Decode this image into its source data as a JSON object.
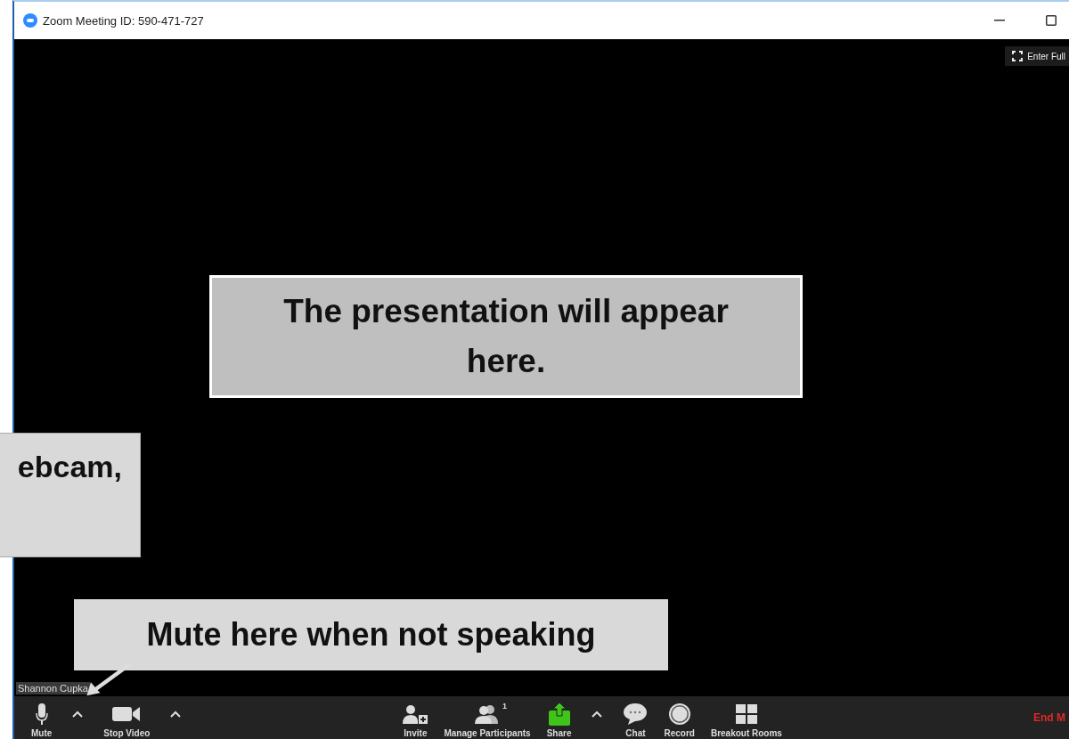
{
  "window": {
    "title": "Zoom Meeting ID: 590-471-727"
  },
  "full_screen_button": {
    "label": "Enter Full"
  },
  "participant_name": "Shannon Cupka",
  "toolbar": {
    "items": [
      {
        "kind": "mic",
        "label": "Mute"
      },
      {
        "kind": "caret"
      },
      {
        "kind": "camera",
        "label": "Stop Video"
      },
      {
        "kind": "caret"
      },
      {
        "kind": "invite",
        "label": "Invite"
      },
      {
        "kind": "participants",
        "label": "Manage Participants",
        "badge": "1"
      },
      {
        "kind": "share",
        "label": "Share"
      },
      {
        "kind": "caret"
      },
      {
        "kind": "chat",
        "label": "Chat"
      },
      {
        "kind": "record",
        "label": "Record"
      },
      {
        "kind": "breakout",
        "label": "Breakout Rooms"
      }
    ],
    "end_button": "End M"
  },
  "callouts": [
    {
      "kind": "main",
      "text": "The presentation will appear here."
    },
    {
      "kind": "side",
      "text": "ebcam,"
    },
    {
      "kind": "pointer",
      "text": "Mute here when not speaking"
    }
  ]
}
